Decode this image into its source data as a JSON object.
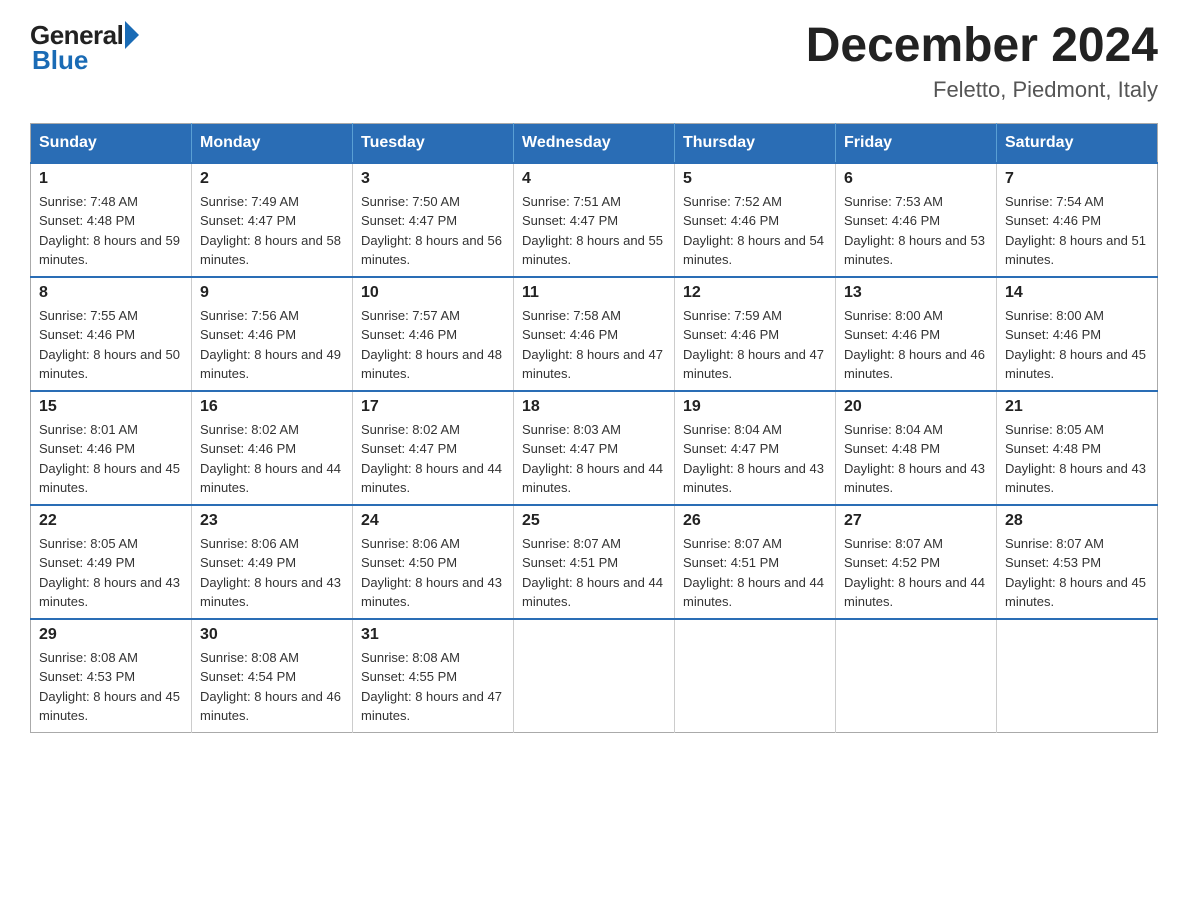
{
  "logo": {
    "general": "General",
    "blue": "Blue"
  },
  "header": {
    "month_title": "December 2024",
    "location": "Feletto, Piedmont, Italy"
  },
  "weekdays": [
    "Sunday",
    "Monday",
    "Tuesday",
    "Wednesday",
    "Thursday",
    "Friday",
    "Saturday"
  ],
  "weeks": [
    [
      {
        "day": "1",
        "sunrise": "7:48 AM",
        "sunset": "4:48 PM",
        "daylight": "8 hours and 59 minutes."
      },
      {
        "day": "2",
        "sunrise": "7:49 AM",
        "sunset": "4:47 PM",
        "daylight": "8 hours and 58 minutes."
      },
      {
        "day": "3",
        "sunrise": "7:50 AM",
        "sunset": "4:47 PM",
        "daylight": "8 hours and 56 minutes."
      },
      {
        "day": "4",
        "sunrise": "7:51 AM",
        "sunset": "4:47 PM",
        "daylight": "8 hours and 55 minutes."
      },
      {
        "day": "5",
        "sunrise": "7:52 AM",
        "sunset": "4:46 PM",
        "daylight": "8 hours and 54 minutes."
      },
      {
        "day": "6",
        "sunrise": "7:53 AM",
        "sunset": "4:46 PM",
        "daylight": "8 hours and 53 minutes."
      },
      {
        "day": "7",
        "sunrise": "7:54 AM",
        "sunset": "4:46 PM",
        "daylight": "8 hours and 51 minutes."
      }
    ],
    [
      {
        "day": "8",
        "sunrise": "7:55 AM",
        "sunset": "4:46 PM",
        "daylight": "8 hours and 50 minutes."
      },
      {
        "day": "9",
        "sunrise": "7:56 AM",
        "sunset": "4:46 PM",
        "daylight": "8 hours and 49 minutes."
      },
      {
        "day": "10",
        "sunrise": "7:57 AM",
        "sunset": "4:46 PM",
        "daylight": "8 hours and 48 minutes."
      },
      {
        "day": "11",
        "sunrise": "7:58 AM",
        "sunset": "4:46 PM",
        "daylight": "8 hours and 47 minutes."
      },
      {
        "day": "12",
        "sunrise": "7:59 AM",
        "sunset": "4:46 PM",
        "daylight": "8 hours and 47 minutes."
      },
      {
        "day": "13",
        "sunrise": "8:00 AM",
        "sunset": "4:46 PM",
        "daylight": "8 hours and 46 minutes."
      },
      {
        "day": "14",
        "sunrise": "8:00 AM",
        "sunset": "4:46 PM",
        "daylight": "8 hours and 45 minutes."
      }
    ],
    [
      {
        "day": "15",
        "sunrise": "8:01 AM",
        "sunset": "4:46 PM",
        "daylight": "8 hours and 45 minutes."
      },
      {
        "day": "16",
        "sunrise": "8:02 AM",
        "sunset": "4:46 PM",
        "daylight": "8 hours and 44 minutes."
      },
      {
        "day": "17",
        "sunrise": "8:02 AM",
        "sunset": "4:47 PM",
        "daylight": "8 hours and 44 minutes."
      },
      {
        "day": "18",
        "sunrise": "8:03 AM",
        "sunset": "4:47 PM",
        "daylight": "8 hours and 44 minutes."
      },
      {
        "day": "19",
        "sunrise": "8:04 AM",
        "sunset": "4:47 PM",
        "daylight": "8 hours and 43 minutes."
      },
      {
        "day": "20",
        "sunrise": "8:04 AM",
        "sunset": "4:48 PM",
        "daylight": "8 hours and 43 minutes."
      },
      {
        "day": "21",
        "sunrise": "8:05 AM",
        "sunset": "4:48 PM",
        "daylight": "8 hours and 43 minutes."
      }
    ],
    [
      {
        "day": "22",
        "sunrise": "8:05 AM",
        "sunset": "4:49 PM",
        "daylight": "8 hours and 43 minutes."
      },
      {
        "day": "23",
        "sunrise": "8:06 AM",
        "sunset": "4:49 PM",
        "daylight": "8 hours and 43 minutes."
      },
      {
        "day": "24",
        "sunrise": "8:06 AM",
        "sunset": "4:50 PM",
        "daylight": "8 hours and 43 minutes."
      },
      {
        "day": "25",
        "sunrise": "8:07 AM",
        "sunset": "4:51 PM",
        "daylight": "8 hours and 44 minutes."
      },
      {
        "day": "26",
        "sunrise": "8:07 AM",
        "sunset": "4:51 PM",
        "daylight": "8 hours and 44 minutes."
      },
      {
        "day": "27",
        "sunrise": "8:07 AM",
        "sunset": "4:52 PM",
        "daylight": "8 hours and 44 minutes."
      },
      {
        "day": "28",
        "sunrise": "8:07 AM",
        "sunset": "4:53 PM",
        "daylight": "8 hours and 45 minutes."
      }
    ],
    [
      {
        "day": "29",
        "sunrise": "8:08 AM",
        "sunset": "4:53 PM",
        "daylight": "8 hours and 45 minutes."
      },
      {
        "day": "30",
        "sunrise": "8:08 AM",
        "sunset": "4:54 PM",
        "daylight": "8 hours and 46 minutes."
      },
      {
        "day": "31",
        "sunrise": "8:08 AM",
        "sunset": "4:55 PM",
        "daylight": "8 hours and 47 minutes."
      },
      null,
      null,
      null,
      null
    ]
  ]
}
